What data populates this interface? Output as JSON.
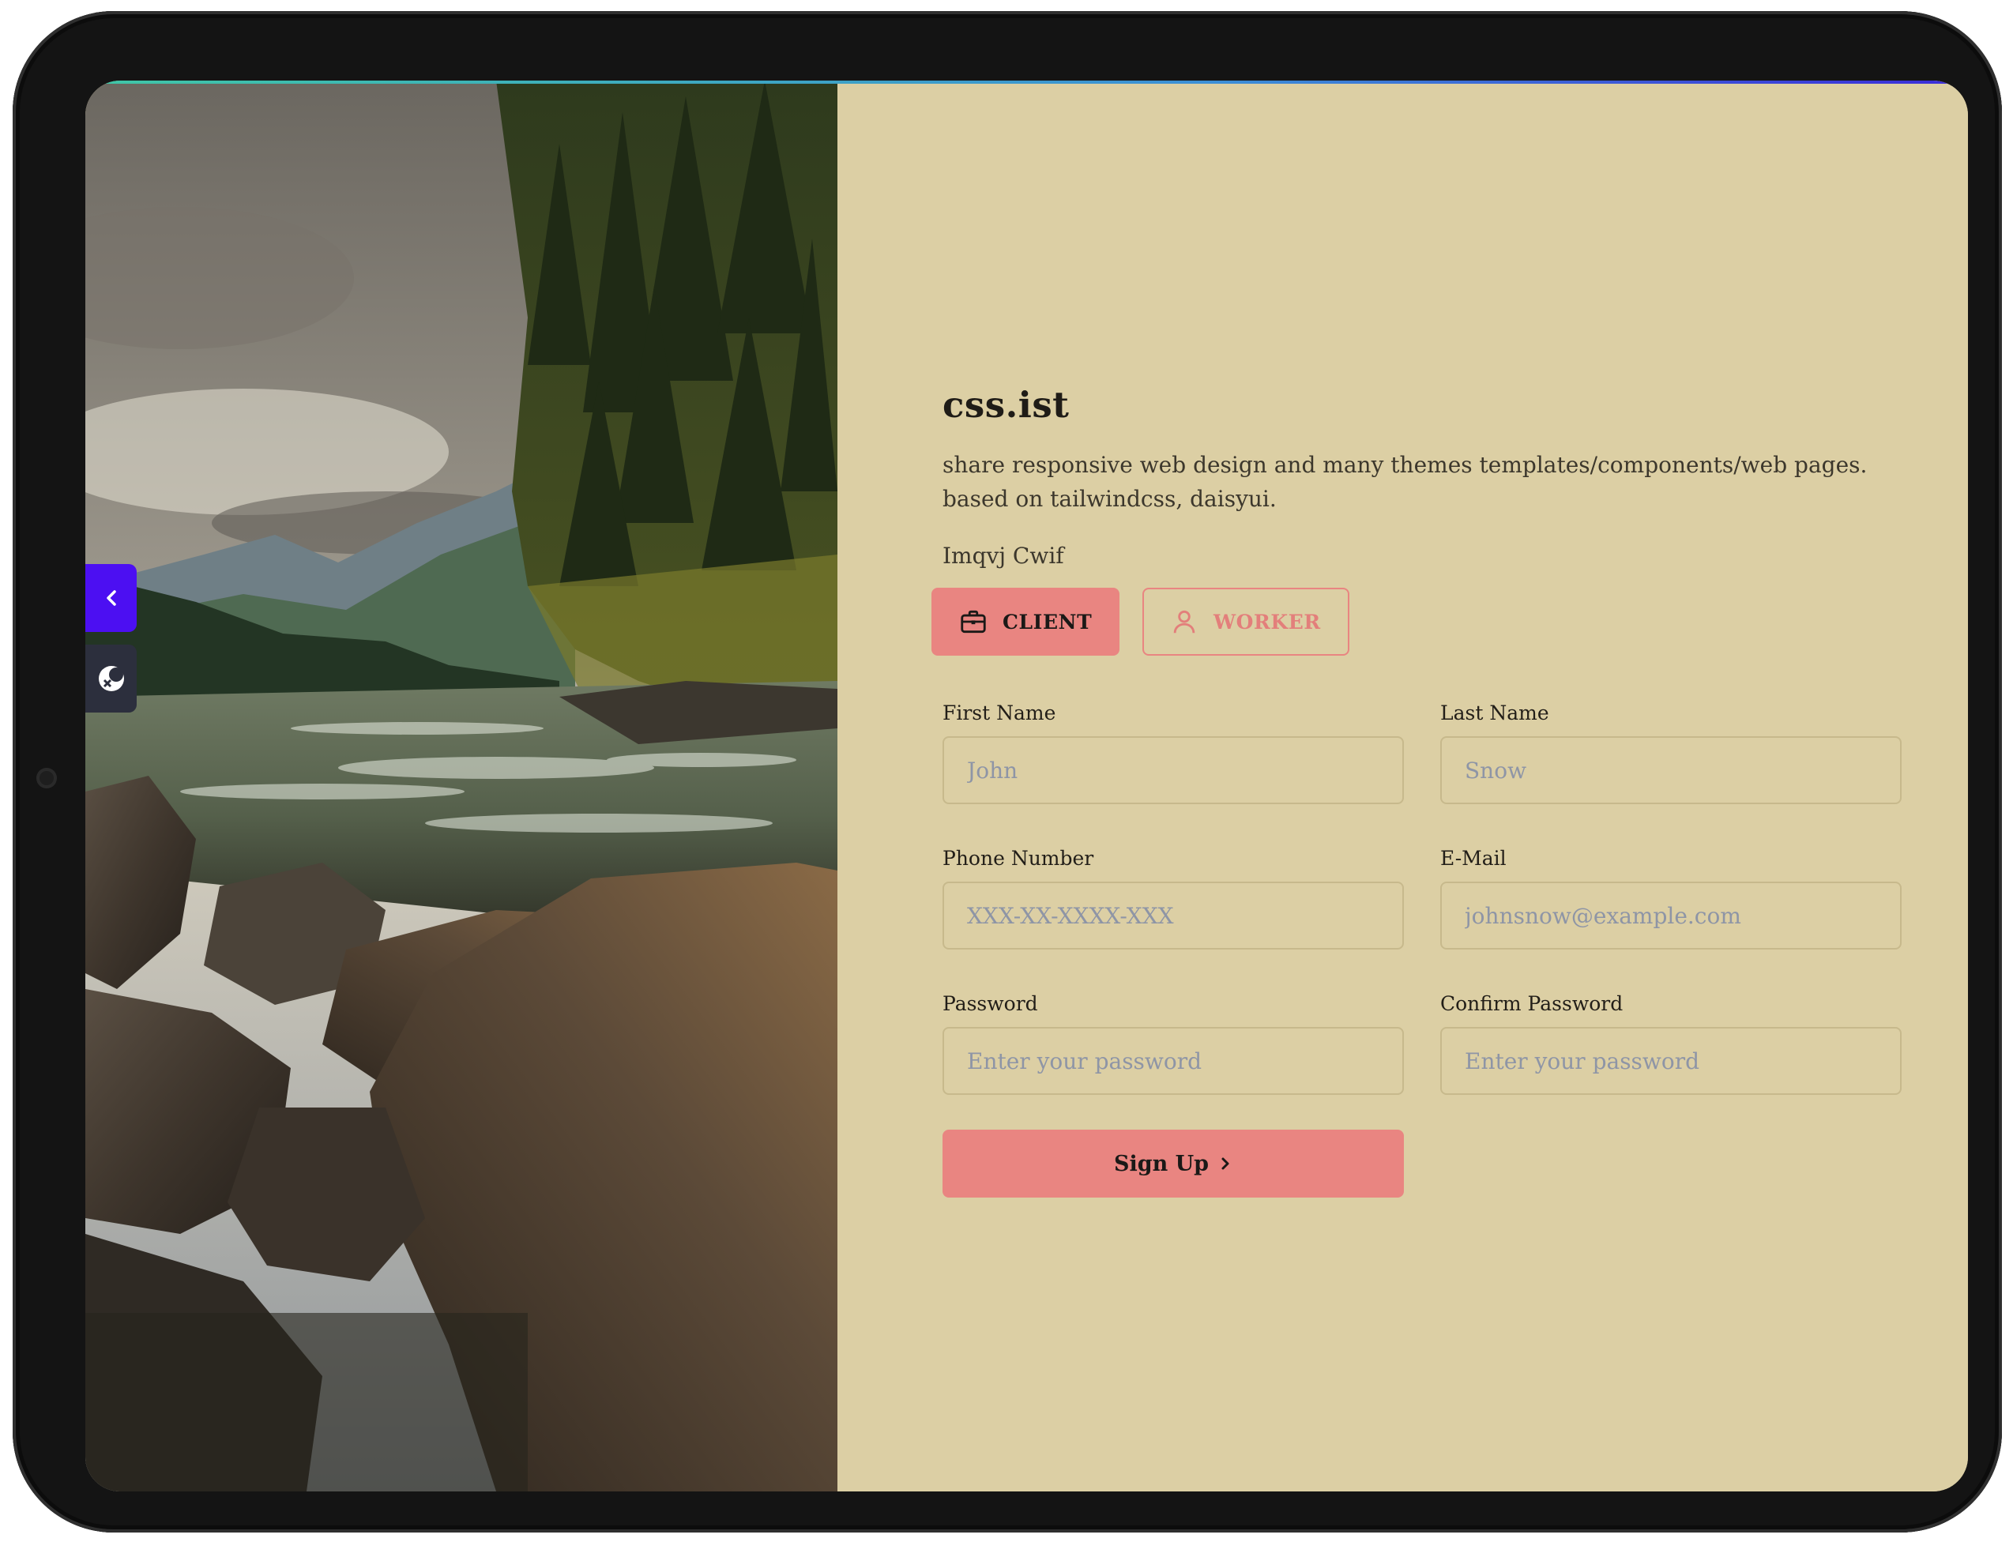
{
  "brand": {
    "title": "css.ist"
  },
  "intro": {
    "description": "share responsive web design and many themes templates/components/web pages. based on tailwindcss, daisyui."
  },
  "account": {
    "label": "Imqvj Cwif",
    "roles": [
      {
        "label": "CLIENT",
        "icon": "briefcase-icon",
        "active": true
      },
      {
        "label": "WORKER",
        "icon": "user-icon",
        "active": false
      }
    ]
  },
  "form": {
    "first_name": {
      "label": "First Name",
      "placeholder": "John"
    },
    "last_name": {
      "label": "Last Name",
      "placeholder": "Snow"
    },
    "phone": {
      "label": "Phone Number",
      "placeholder": "XXX-XX-XXXX-XXX"
    },
    "email": {
      "label": "E-Mail",
      "placeholder": "johnsnow@example.com"
    },
    "password": {
      "label": "Password",
      "placeholder": "Enter your password"
    },
    "confirm_password": {
      "label": "Confirm Password",
      "placeholder": "Enter your password"
    },
    "submit_label": "Sign Up"
  },
  "side_controls": [
    {
      "icon": "chevron-left-icon",
      "color": "#4c0ff2"
    },
    {
      "icon": "theme-toggle-icon",
      "color": "#2c2f3d"
    }
  ],
  "colors": {
    "accent": "#e98581",
    "panel": "#dccfa4",
    "side_primary": "#4c0ff2"
  }
}
